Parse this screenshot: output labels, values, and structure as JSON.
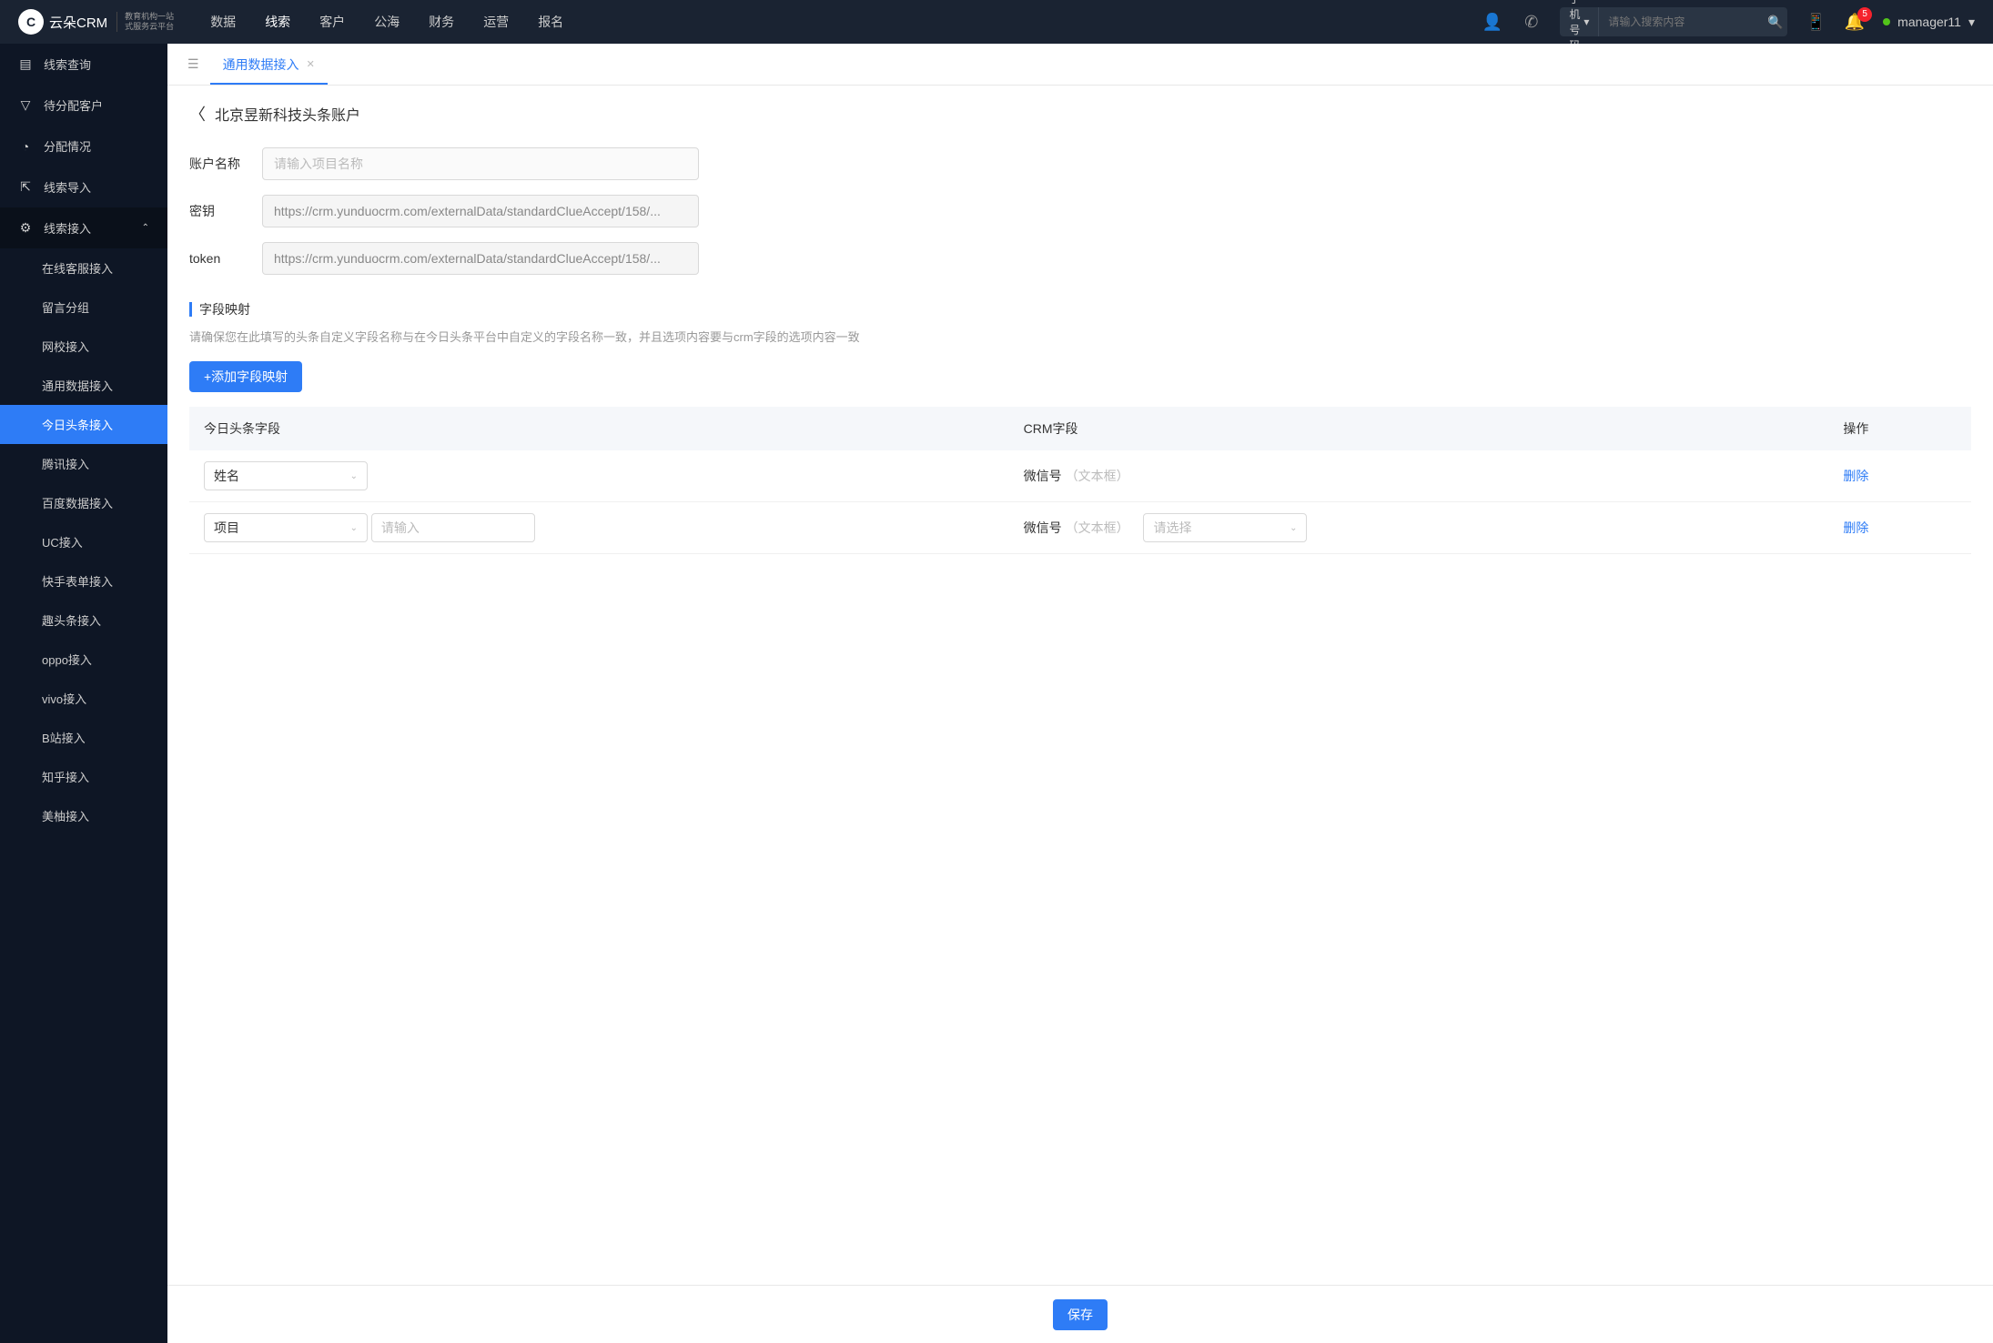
{
  "header": {
    "logo_text": "云朵CRM",
    "logo_sub1": "教育机构一站",
    "logo_sub2": "式服务云平台",
    "nav": [
      "数据",
      "线索",
      "客户",
      "公海",
      "财务",
      "运营",
      "报名"
    ],
    "nav_active": 1,
    "search_type": "手机号码",
    "search_placeholder": "请输入搜索内容",
    "notif_count": "5",
    "username": "manager11"
  },
  "sidebar": {
    "items": [
      {
        "icon": "▤",
        "label": "线索查询"
      },
      {
        "icon": "▽",
        "label": "待分配客户"
      },
      {
        "icon": "◔",
        "label": "分配情况"
      },
      {
        "icon": "⇱",
        "label": "线索导入"
      },
      {
        "icon": "⚙",
        "label": "线索接入",
        "expanded": true,
        "children": [
          "在线客服接入",
          "留言分组",
          "网校接入",
          "通用数据接入",
          "今日头条接入",
          "腾讯接入",
          "百度数据接入",
          "UC接入",
          "快手表单接入",
          "趣头条接入",
          "oppo接入",
          "vivo接入",
          "B站接入",
          "知乎接入",
          "美柚接入"
        ],
        "active_child": 4
      }
    ]
  },
  "tabs": {
    "items": [
      "通用数据接入"
    ],
    "active": 0
  },
  "page": {
    "title": "北京昱新科技头条账户",
    "form": {
      "account_name_label": "账户名称",
      "account_name_placeholder": "请输入项目名称",
      "secret_label": "密钥",
      "secret_value": "https://crm.yunduocrm.com/externalData/standardClueAccept/158/...",
      "token_label": "token",
      "token_value": "https://crm.yunduocrm.com/externalData/standardClueAccept/158/..."
    },
    "section": {
      "title": "字段映射",
      "hint": "请确保您在此填写的头条自定义字段名称与在今日头条平台中自定义的字段名称一致，并且选项内容要与crm字段的选项内容一致",
      "add_btn": "+添加字段映射"
    },
    "table": {
      "headers": [
        "今日头条字段",
        "CRM字段",
        "操作"
      ],
      "rows": [
        {
          "tt_field": "姓名",
          "crm_field": "微信号",
          "crm_type": "（文本框）",
          "has_extra": false
        },
        {
          "tt_field": "项目",
          "extra_placeholder": "请输入",
          "crm_field": "微信号",
          "crm_type": "（文本框）",
          "select_placeholder": "请选择",
          "has_extra": true
        }
      ],
      "delete_label": "删除"
    },
    "save_btn": "保存"
  }
}
